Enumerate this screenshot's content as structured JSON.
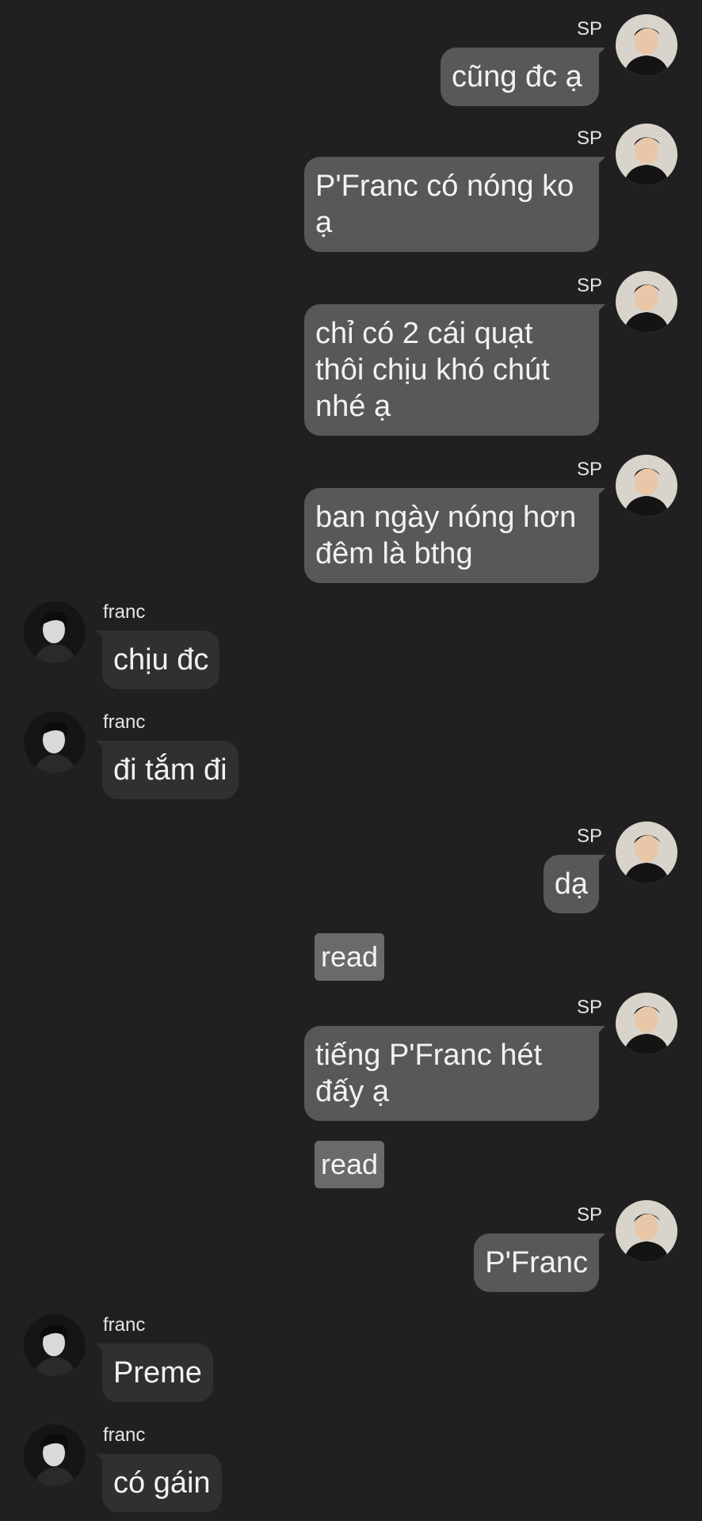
{
  "colors": {
    "background": "#202020",
    "outgoing_bubble": "#585858",
    "incoming_bubble": "#303030",
    "read_badge": "#6a6a6a"
  },
  "messages": [
    {
      "sender": "SP",
      "text": "cũng đc ạ"
    },
    {
      "sender": "SP",
      "text": "P'Franc có nóng ko ạ"
    },
    {
      "sender": "SP",
      "text": "chỉ có 2 cái quạt thôi chịu khó chút nhé ạ"
    },
    {
      "sender": "SP",
      "text": "ban ngày nóng hơn đêm là bthg"
    },
    {
      "sender": "franc",
      "text": "chịu đc"
    },
    {
      "sender": "franc",
      "text": "đi tắm đi"
    },
    {
      "sender": "SP",
      "text": "dạ"
    },
    {
      "status": "read"
    },
    {
      "sender": "SP",
      "text": "tiếng P'Franc hét đấy ạ"
    },
    {
      "status": "read"
    },
    {
      "sender": "SP",
      "text": "P'Franc"
    },
    {
      "sender": "franc",
      "text": "Preme"
    },
    {
      "sender": "franc",
      "text": "có gáin"
    }
  ]
}
